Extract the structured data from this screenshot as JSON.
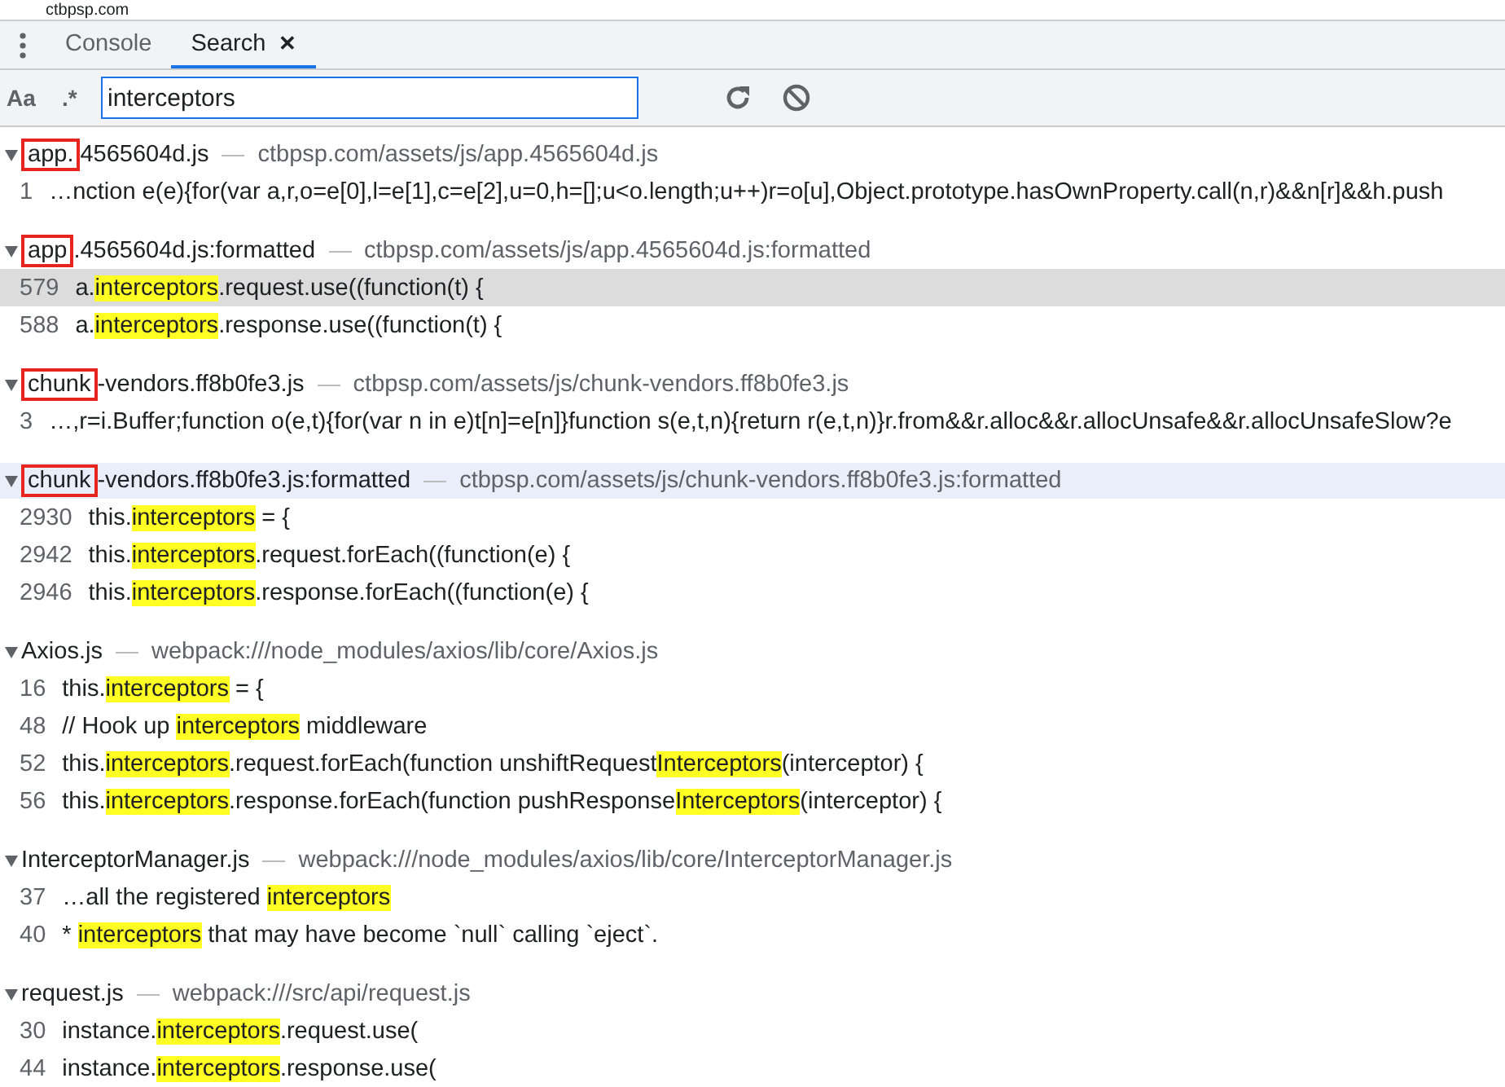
{
  "top_strip": {
    "text": "ctbpsp.com"
  },
  "tabs": [
    {
      "label": "Console",
      "selected": false
    },
    {
      "label": "Search",
      "selected": true,
      "close": "✕"
    }
  ],
  "search": {
    "case_toggle": "Aa",
    "regex_toggle": ".*",
    "value": "interceptors"
  },
  "results": [
    {
      "name_parts": [
        {
          "text": "app.",
          "boxed": true
        },
        {
          "text": "4565604d.js",
          "boxed": false
        }
      ],
      "path": "ctbpsp.com/assets/js/app.4565604d.js",
      "focused": false,
      "lines": [
        {
          "num": "1",
          "selected": false,
          "parts": [
            {
              "text": "…nction e(e){for(var a,r,o=e[0],l=e[1],c=e[2],u=0,h=[];u<o.length;u++)r=o[u],Object.prototype.hasOwnProperty.call(n,r)&&n[r]&&h.push",
              "match": false
            }
          ]
        }
      ]
    },
    {
      "name_parts": [
        {
          "text": "app",
          "boxed": true
        },
        {
          "text": ".4565604d.js:formatted",
          "boxed": false
        }
      ],
      "path": "ctbpsp.com/assets/js/app.4565604d.js:formatted",
      "focused": false,
      "lines": [
        {
          "num": "579",
          "selected": true,
          "parts": [
            {
              "text": "a.",
              "match": false
            },
            {
              "text": "interceptors",
              "match": true
            },
            {
              "text": ".request.use((function(t) {",
              "match": false
            }
          ]
        },
        {
          "num": "588",
          "selected": false,
          "parts": [
            {
              "text": "a.",
              "match": false
            },
            {
              "text": "interceptors",
              "match": true
            },
            {
              "text": ".response.use((function(t) {",
              "match": false
            }
          ]
        }
      ]
    },
    {
      "name_parts": [
        {
          "text": "chunk",
          "boxed": true
        },
        {
          "text": "-vendors.ff8b0fe3.js",
          "boxed": false
        }
      ],
      "path": "ctbpsp.com/assets/js/chunk-vendors.ff8b0fe3.js",
      "focused": false,
      "lines": [
        {
          "num": "3",
          "selected": false,
          "parts": [
            {
              "text": "…,r=i.Buffer;function o(e,t){for(var n in e)t[n]=e[n]}function s(e,t,n){return r(e,t,n)}r.from&&r.alloc&&r.allocUnsafe&&r.allocUnsafeSlow?e",
              "match": false
            }
          ]
        }
      ]
    },
    {
      "name_parts": [
        {
          "text": "chunk",
          "boxed": true
        },
        {
          "text": "-vendors.ff8b0fe3.js:formatted",
          "boxed": false
        }
      ],
      "path": "ctbpsp.com/assets/js/chunk-vendors.ff8b0fe3.js:formatted",
      "focused": true,
      "lines": [
        {
          "num": "2930",
          "selected": false,
          "parts": [
            {
              "text": "this.",
              "match": false
            },
            {
              "text": "interceptors",
              "match": true
            },
            {
              "text": " = {",
              "match": false
            }
          ]
        },
        {
          "num": "2942",
          "selected": false,
          "parts": [
            {
              "text": "this.",
              "match": false
            },
            {
              "text": "interceptors",
              "match": true
            },
            {
              "text": ".request.forEach((function(e) {",
              "match": false
            }
          ]
        },
        {
          "num": "2946",
          "selected": false,
          "parts": [
            {
              "text": "this.",
              "match": false
            },
            {
              "text": "interceptors",
              "match": true
            },
            {
              "text": ".response.forEach((function(e) {",
              "match": false
            }
          ]
        }
      ]
    },
    {
      "name_parts": [
        {
          "text": "Axios.js",
          "boxed": false
        }
      ],
      "path": "webpack:///node_modules/axios/lib/core/Axios.js",
      "focused": false,
      "lines": [
        {
          "num": "16",
          "selected": false,
          "parts": [
            {
              "text": "this.",
              "match": false
            },
            {
              "text": "interceptors",
              "match": true
            },
            {
              "text": " = {",
              "match": false
            }
          ]
        },
        {
          "num": "48",
          "selected": false,
          "parts": [
            {
              "text": "// Hook up ",
              "match": false
            },
            {
              "text": "interceptors",
              "match": true
            },
            {
              "text": " middleware",
              "match": false
            }
          ]
        },
        {
          "num": "52",
          "selected": false,
          "parts": [
            {
              "text": "this.",
              "match": false
            },
            {
              "text": "interceptors",
              "match": true
            },
            {
              "text": ".request.forEach(function unshiftRequest",
              "match": false
            },
            {
              "text": "Interceptors",
              "match": true
            },
            {
              "text": "(interceptor) {",
              "match": false
            }
          ]
        },
        {
          "num": "56",
          "selected": false,
          "parts": [
            {
              "text": "this.",
              "match": false
            },
            {
              "text": "interceptors",
              "match": true
            },
            {
              "text": ".response.forEach(function pushResponse",
              "match": false
            },
            {
              "text": "Interceptors",
              "match": true
            },
            {
              "text": "(interceptor) {",
              "match": false
            }
          ]
        }
      ]
    },
    {
      "name_parts": [
        {
          "text": "InterceptorManager.js",
          "boxed": false
        }
      ],
      "path": "webpack:///node_modules/axios/lib/core/InterceptorManager.js",
      "focused": false,
      "lines": [
        {
          "num": "37",
          "selected": false,
          "parts": [
            {
              "text": "…all the registered ",
              "match": false
            },
            {
              "text": "interceptors",
              "match": true
            }
          ]
        },
        {
          "num": "40",
          "selected": false,
          "parts": [
            {
              "text": "* ",
              "match": false
            },
            {
              "text": "interceptors",
              "match": true
            },
            {
              "text": " that may have become `null` calling `eject`.",
              "match": false
            }
          ]
        }
      ]
    },
    {
      "name_parts": [
        {
          "text": "request.js",
          "boxed": false
        }
      ],
      "path": "webpack:///src/api/request.js",
      "focused": false,
      "lines": [
        {
          "num": "30",
          "selected": false,
          "parts": [
            {
              "text": "instance.",
              "match": false
            },
            {
              "text": "interceptors",
              "match": true
            },
            {
              "text": ".request.use(",
              "match": false
            }
          ]
        },
        {
          "num": "44",
          "selected": false,
          "parts": [
            {
              "text": "instance.",
              "match": false
            },
            {
              "text": "interceptors",
              "match": true
            },
            {
              "text": ".response.use(",
              "match": false
            }
          ]
        }
      ]
    }
  ]
}
